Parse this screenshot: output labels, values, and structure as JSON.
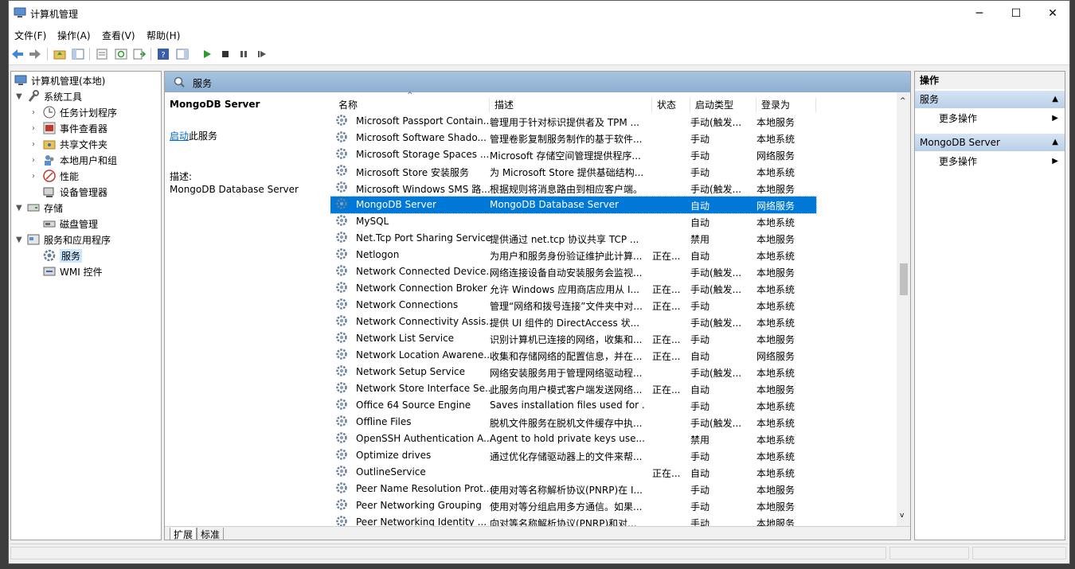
{
  "window": {
    "title": "计算机管理"
  },
  "menu": [
    "文件(F)",
    "操作(A)",
    "查看(V)",
    "帮助(H)"
  ],
  "tree": {
    "root": "计算机管理(本地)",
    "system_tools": "系统工具",
    "task_scheduler": "任务计划程序",
    "event_viewer": "事件查看器",
    "shared_folders": "共享文件夹",
    "local_users": "本地用户和组",
    "performance": "性能",
    "device_manager": "设备管理器",
    "storage": "存储",
    "disk_mgmt": "磁盘管理",
    "services_apps": "服务和应用程序",
    "services": "服务",
    "wmi": "WMI 控件"
  },
  "center": {
    "header_title": "服务",
    "detail": {
      "service_name": "MongoDB Server",
      "start_link": "启动",
      "start_suffix": "此服务",
      "desc_label": "描述:",
      "desc_value": "MongoDB Database Server"
    },
    "columns": {
      "name": "名称",
      "desc": "描述",
      "status": "状态",
      "startup": "启动类型",
      "logon": "登录为"
    },
    "rows": [
      {
        "name": "Microsoft Passport Contain...",
        "desc": "管理用于针对标识提供者及 TPM ...",
        "status": "",
        "startup": "手动(触发...",
        "logon": "本地服务"
      },
      {
        "name": "Microsoft Software Shado...",
        "desc": "管理卷影复制服务制作的基于软件...",
        "status": "",
        "startup": "手动",
        "logon": "本地系统"
      },
      {
        "name": "Microsoft Storage Spaces ...",
        "desc": "Microsoft 存储空间管理提供程序...",
        "status": "",
        "startup": "手动",
        "logon": "网络服务"
      },
      {
        "name": "Microsoft Store 安装服务",
        "desc": "为 Microsoft Store 提供基础结构...",
        "status": "",
        "startup": "手动",
        "logon": "本地系统"
      },
      {
        "name": "Microsoft Windows SMS 路...",
        "desc": "根据规则将消息路由到相应客户端。",
        "status": "",
        "startup": "手动(触发...",
        "logon": "本地服务"
      },
      {
        "name": "MongoDB Server",
        "desc": "MongoDB Database Server",
        "status": "",
        "startup": "自动",
        "logon": "网络服务",
        "selected": true
      },
      {
        "name": "MySQL",
        "desc": "",
        "status": "",
        "startup": "自动",
        "logon": "本地系统"
      },
      {
        "name": "Net.Tcp Port Sharing Service",
        "desc": "提供通过 net.tcp 协议共享 TCP ...",
        "status": "",
        "startup": "禁用",
        "logon": "本地服务"
      },
      {
        "name": "Netlogon",
        "desc": "为用户和服务身份验证维护此计算...",
        "status": "正在...",
        "startup": "自动",
        "logon": "本地系统"
      },
      {
        "name": "Network Connected Device...",
        "desc": "网络连接设备自动安装服务会监视...",
        "status": "",
        "startup": "手动(触发...",
        "logon": "本地服务"
      },
      {
        "name": "Network Connection Broker",
        "desc": "允许 Windows 应用商店应用从 I...",
        "status": "正在...",
        "startup": "手动(触发...",
        "logon": "本地系统"
      },
      {
        "name": "Network Connections",
        "desc": "管理“网络和拨号连接”文件夹中对...",
        "status": "正在...",
        "startup": "手动",
        "logon": "本地系统"
      },
      {
        "name": "Network Connectivity Assis...",
        "desc": "提供 UI 组件的 DirectAccess 状...",
        "status": "",
        "startup": "手动(触发...",
        "logon": "本地系统"
      },
      {
        "name": "Network List Service",
        "desc": "识别计算机已连接的网络，收集和...",
        "status": "正在...",
        "startup": "手动",
        "logon": "本地服务"
      },
      {
        "name": "Network Location Awarene...",
        "desc": "收集和存储网络的配置信息，并在...",
        "status": "正在...",
        "startup": "自动",
        "logon": "网络服务"
      },
      {
        "name": "Network Setup Service",
        "desc": "网络安装服务用于管理网络驱动程...",
        "status": "",
        "startup": "手动(触发...",
        "logon": "本地系统"
      },
      {
        "name": "Network Store Interface Se...",
        "desc": "此服务向用户模式客户端发送网络...",
        "status": "正在...",
        "startup": "自动",
        "logon": "本地服务"
      },
      {
        "name": "Office 64 Source Engine",
        "desc": "Saves installation files used for ...",
        "status": "",
        "startup": "手动",
        "logon": "本地系统"
      },
      {
        "name": "Offline Files",
        "desc": "脱机文件服务在脱机文件缓存中执...",
        "status": "",
        "startup": "手动(触发...",
        "logon": "本地系统"
      },
      {
        "name": "OpenSSH Authentication A...",
        "desc": "Agent to hold private keys use...",
        "status": "",
        "startup": "禁用",
        "logon": "本地系统"
      },
      {
        "name": "Optimize drives",
        "desc": "通过优化存储驱动器上的文件来帮...",
        "status": "",
        "startup": "手动",
        "logon": "本地系统"
      },
      {
        "name": "OutlineService",
        "desc": "",
        "status": "正在...",
        "startup": "自动",
        "logon": "本地系统"
      },
      {
        "name": "Peer Name Resolution Prot...",
        "desc": "使用对等名称解析协议(PNRP)在 I...",
        "status": "",
        "startup": "手动",
        "logon": "本地服务"
      },
      {
        "name": "Peer Networking Grouping",
        "desc": "使用对等分组启用多方通信。如果...",
        "status": "",
        "startup": "手动",
        "logon": "本地服务"
      },
      {
        "name": "Peer Networking Identity ...",
        "desc": "向对等名称解析协议(PNRP)和对...",
        "status": "",
        "startup": "手动",
        "logon": "本地服务"
      }
    ],
    "tabs": [
      "扩展",
      "标准"
    ]
  },
  "actions": {
    "header": "操作",
    "section1": "服务",
    "more1": "更多操作",
    "section2": "MongoDB Server",
    "more2": "更多操作"
  }
}
